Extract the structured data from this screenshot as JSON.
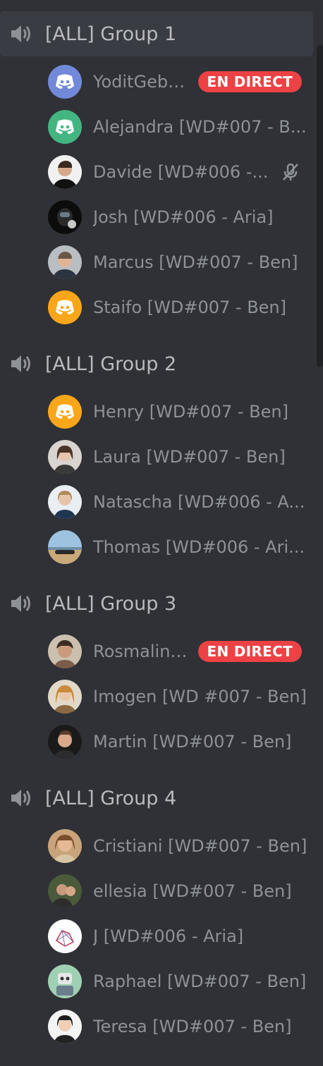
{
  "live_label": "EN DIRECT",
  "colors": {
    "background": "#2f3136",
    "active_channel_bg": "#393c43",
    "live_badge": "#ed4245",
    "discord_blurple": "#7289da",
    "discord_green": "#43b581",
    "discord_yellow": "#faa61a"
  },
  "groups": [
    {
      "name": "[ALL] Group 1",
      "icon": "speaker-icon",
      "users": [
        {
          "name": "YoditGeb ...",
          "avatar": "discord-logo-blurple",
          "live": true
        },
        {
          "name": "Alejandra [WD#007 - B...",
          "avatar": "discord-logo-green"
        },
        {
          "name": "Davide [WD#006 -...",
          "avatar": "photo",
          "muted": true,
          "mute_icon": "mic-muted-icon"
        },
        {
          "name": "Josh [WD#006 - Aria]",
          "avatar": "photo"
        },
        {
          "name": "Marcus [WD#007 - Ben]",
          "avatar": "photo"
        },
        {
          "name": "Staifo [WD#007 - Ben]",
          "avatar": "discord-logo-yellow"
        }
      ]
    },
    {
      "name": "[ALL] Group 2",
      "icon": "speaker-icon",
      "users": [
        {
          "name": "Henry [WD#007 - Ben]",
          "avatar": "discord-logo-yellow"
        },
        {
          "name": "Laura [WD#007 - Ben]",
          "avatar": "photo"
        },
        {
          "name": "Natascha [WD#006 - A...",
          "avatar": "photo"
        },
        {
          "name": "Thomas [WD#006 - Ari...",
          "avatar": "photo"
        }
      ]
    },
    {
      "name": "[ALL] Group 3",
      "icon": "speaker-icon",
      "users": [
        {
          "name": "Rosmalina...",
          "avatar": "photo",
          "live": true
        },
        {
          "name": "Imogen [WD #007 - Ben]",
          "avatar": "photo"
        },
        {
          "name": "Martin [WD#007 - Ben]",
          "avatar": "photo"
        }
      ]
    },
    {
      "name": "[ALL] Group 4",
      "icon": "speaker-icon",
      "users": [
        {
          "name": "Cristiani [WD#007 - Ben]",
          "avatar": "photo"
        },
        {
          "name": "ellesia [WD#007 - Ben]",
          "avatar": "photo"
        },
        {
          "name": "J [WD#006 - Aria]",
          "avatar": "photo"
        },
        {
          "name": "Raphael [WD#007 - Ben]",
          "avatar": "photo"
        },
        {
          "name": "Teresa [WD#007 - Ben]",
          "avatar": "photo"
        }
      ]
    }
  ]
}
